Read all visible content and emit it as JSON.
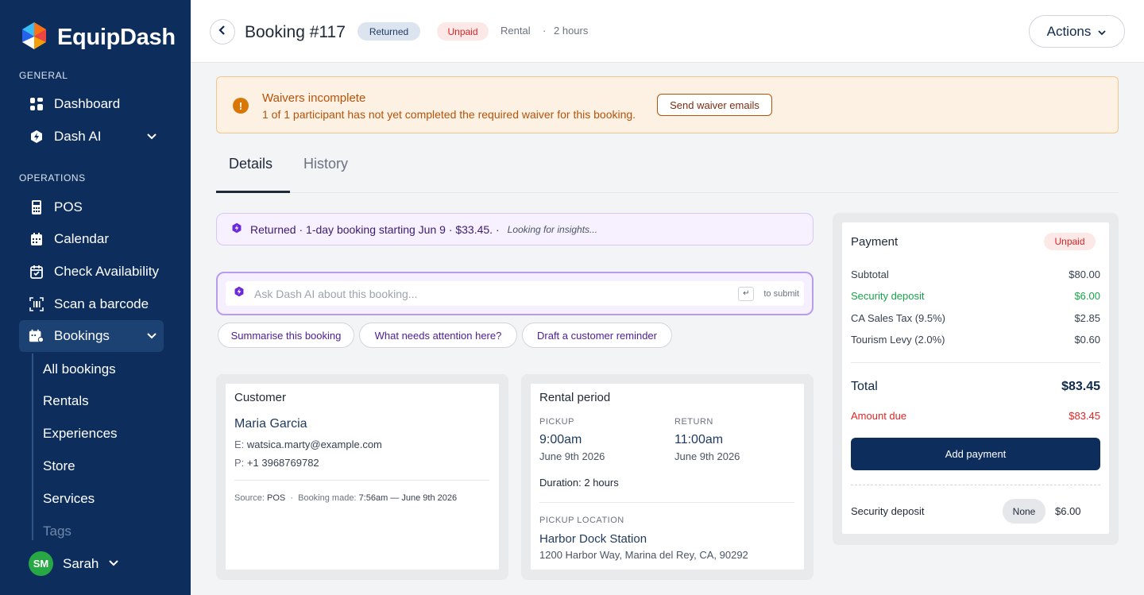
{
  "app": {
    "name": "EquipDash"
  },
  "sidebar": {
    "general_label": "GENERAL",
    "operations_label": "OPERATIONS",
    "general_items": [
      {
        "label": "Dashboard",
        "icon": "dashboard-icon"
      },
      {
        "label": "Dash AI",
        "icon": "dash-ai-icon"
      }
    ],
    "operations_items": [
      {
        "label": "POS",
        "icon": "pos-icon"
      },
      {
        "label": "Calendar",
        "icon": "calendar-icon"
      },
      {
        "label": "Check Availability",
        "icon": "check-availability-icon"
      },
      {
        "label": "Scan a barcode",
        "icon": "barcode-icon"
      },
      {
        "label": "Bookings",
        "icon": "bookings-icon"
      }
    ],
    "booking_subitems": [
      "All bookings",
      "Rentals",
      "Experiences",
      "Store",
      "Services",
      "Tags"
    ],
    "user": {
      "initials": "SM",
      "name": "Sarah"
    }
  },
  "header": {
    "title": "Booking #117",
    "status_badge": "Returned",
    "payment_badge": "Unpaid",
    "type": "Rental",
    "separator": "·",
    "duration": "2 hours",
    "actions_label": "Actions"
  },
  "waiver_alert": {
    "icon": "!",
    "title": "Waivers incomplete",
    "message": "1 of 1 participant has not yet completed the required waiver for this booking.",
    "button": "Send waiver emails"
  },
  "tabs": [
    {
      "label": "Details",
      "active": true
    },
    {
      "label": "History",
      "active": false
    }
  ],
  "ai": {
    "summary": "Returned · 1-day booking starting Jun 9 · $33.45. ·",
    "summary_note": "Looking for insights...",
    "ask_placeholder": "Ask Dash AI about this booking...",
    "submit_key": "↵",
    "submit_hint": "to submit",
    "suggestions": [
      "Summarise this booking",
      "What needs attention here?",
      "Draft a customer reminder"
    ]
  },
  "customer": {
    "title": "Customer",
    "name": "Maria Garcia",
    "email_label": "E:",
    "email": "watsica.marty@example.com",
    "phone_label": "P:",
    "phone": "+1 3968769782",
    "source_label": "Source:",
    "source": "POS",
    "made_label": "Booking made:",
    "made": "7:56am — June 9th 2026"
  },
  "rental": {
    "title": "Rental period",
    "pickup_label": "PICKUP",
    "pickup_time": "9:00am",
    "pickup_date": "June 9th 2026",
    "return_label": "RETURN",
    "return_time": "11:00am",
    "return_date": "June 9th 2026",
    "duration": "Duration: 2 hours",
    "location_label": "PICKUP LOCATION",
    "location_name": "Harbor Dock Station",
    "location_address": "1200 Harbor Way, Marina del Rey, CA, 90292"
  },
  "payment": {
    "title": "Payment",
    "status": "Unpaid",
    "rows": [
      {
        "label": "Subtotal",
        "value": "$80.00"
      },
      {
        "label": "Security deposit",
        "value": "$6.00"
      },
      {
        "label": "CA Sales Tax (9.5%)",
        "value": "$2.85"
      },
      {
        "label": "Tourism Levy (2.0%)",
        "value": "$0.60"
      }
    ],
    "total_label": "Total",
    "total": "$83.45",
    "due_label": "Amount due",
    "due": "$83.45",
    "add_button": "Add payment",
    "deposit_label": "Security deposit",
    "deposit_status": "None",
    "deposit_value": "$6.00"
  },
  "colors": {
    "sidebar": "#0d2e5c",
    "accent_purple": "#6d28d9",
    "unpaid_red": "#dc2626",
    "deposit_green": "#16a34a",
    "warning": "#d97706"
  }
}
